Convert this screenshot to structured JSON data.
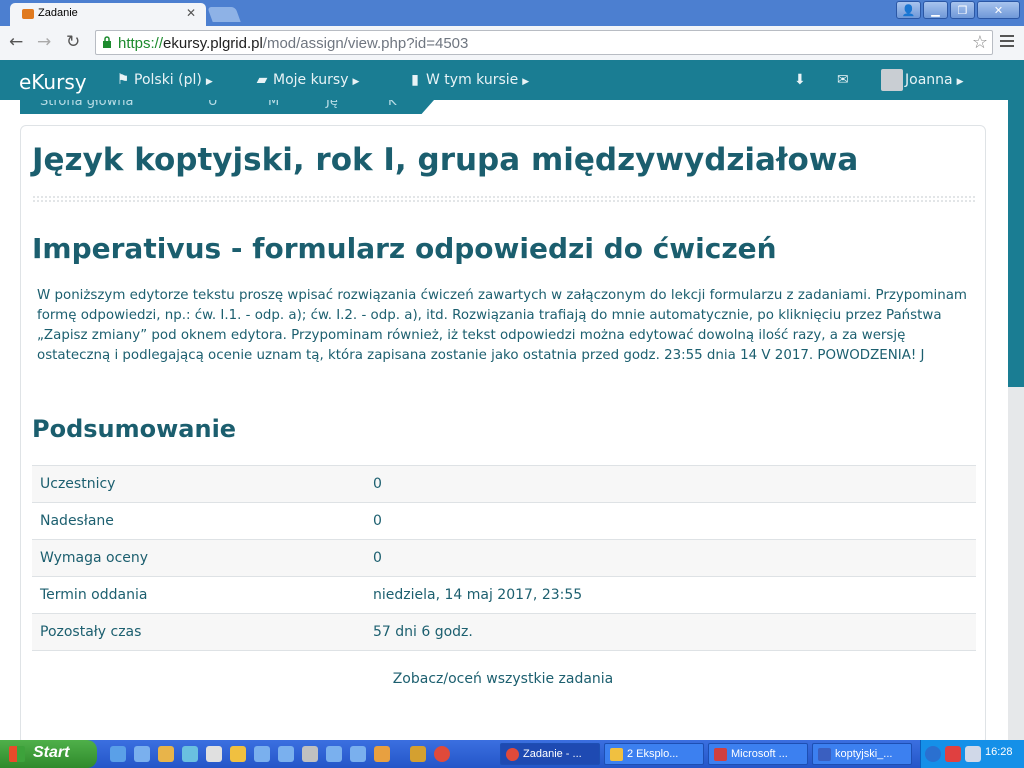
{
  "browser": {
    "tab_title": "Zadanie",
    "url_scheme": "https://",
    "url_host": "ekursy.plgrid.pl",
    "url_path": "/mod/assign/view.php?id=4503"
  },
  "navbar": {
    "brand": "eKursy",
    "language": "Polski (pl)",
    "my_courses": "Moje kursy",
    "this_course": "W tym kursie",
    "user": "Joanna"
  },
  "breadcrumb": {
    "home": "Strona główna",
    "c1": "U",
    "c2": "M",
    "c3": "Ję",
    "c4": "K"
  },
  "page": {
    "course_title": "Język koptyjski, rok I, grupa międzywydziałowa",
    "assignment_title": "Imperativus - formularz odpowiedzi do ćwiczeń",
    "intro": "W poniższym edytorze tekstu proszę wpisać rozwiązania ćwiczeń zawartych w załączonym do lekcji formularzu z zadaniami. Przypominam formę odpowiedzi, np.: ćw. I.1. - odp. a); ćw. I.2. - odp. a), itd. Rozwiązania trafiają do mnie automatycznie, po kliknięciu przez Państwa „Zapisz zmiany” pod oknem edytora. Przypominam również, iż tekst odpowiedzi można edytować dowolną ilość razy, a za wersję ostateczną i podlegającą ocenie uznam tą, która zapisana zostanie jako ostatnia przed godz. 23:55  dnia 14 V 2017. POWODZENIA! J",
    "summary_heading": "Podsumowanie",
    "summary": [
      {
        "label": "Uczestnicy",
        "value": "0"
      },
      {
        "label": "Nadesłane",
        "value": "0"
      },
      {
        "label": "Wymaga oceny",
        "value": "0"
      },
      {
        "label": "Termin oddania",
        "value": "niedziela, 14 maj 2017, 23:55"
      },
      {
        "label": "Pozostały czas",
        "value": "57 dni 6 godz."
      }
    ],
    "grade_link": "Zobacz/oceń wszystkie zadania"
  },
  "taskbar": {
    "start": "Start",
    "tasks": [
      "Zadanie - ...",
      "2 Eksplo...",
      "Microsoft ...",
      "koptyjski_..."
    ],
    "clock": "16:28"
  },
  "colors": {
    "brand_teal": "#1a7d93",
    "heading": "#1b5e6e"
  }
}
